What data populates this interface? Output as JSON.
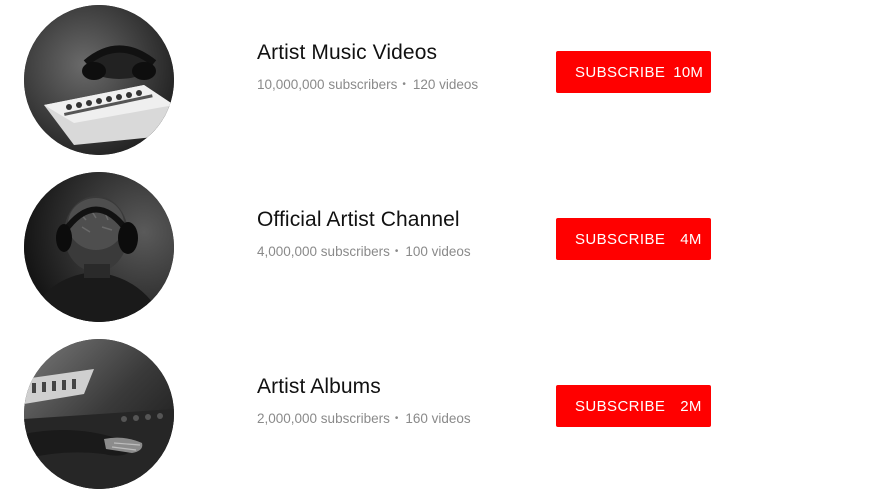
{
  "channels": [
    {
      "title": "Artist Music Videos",
      "subscribers": "10,000,000 subscribers",
      "dot": "•",
      "videos": "120 videos",
      "subscribe_label": "SUBSCRIBE",
      "subscribe_count": "10M",
      "avatar": "mixing-console-photo"
    },
    {
      "title": "Official Artist Channel",
      "subscribers": "4,000,000 subscribers",
      "dot": "•",
      "videos": "100 videos",
      "subscribe_label": "SUBSCRIBE",
      "subscribe_count": "4M",
      "avatar": "headphones-person-photo"
    },
    {
      "title": "Artist Albums",
      "subscribers": "2,000,000 subscribers",
      "dot": "•",
      "videos": "160 videos",
      "subscribe_label": "SUBSCRIBE",
      "subscribe_count": "2M",
      "avatar": "hands-on-console-photo"
    }
  ],
  "colors": {
    "subscribe_bg": "#ff0000",
    "title_text": "#111111",
    "meta_text": "#8a8a8a"
  }
}
